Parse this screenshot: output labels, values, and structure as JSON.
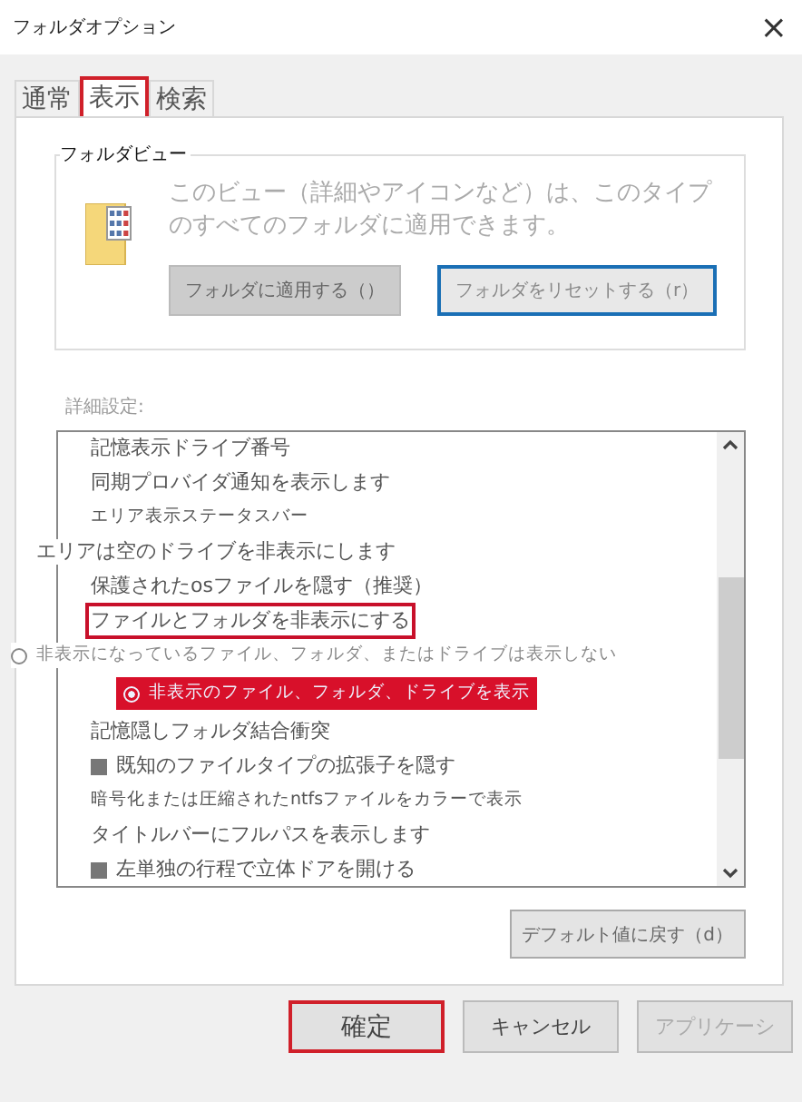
{
  "window": {
    "title": "フォルダオプション",
    "close": "×"
  },
  "tabs": [
    {
      "label": "通常",
      "selected": false,
      "highlighted": false
    },
    {
      "label": "表示",
      "selected": true,
      "highlighted": true
    },
    {
      "label": "検索",
      "selected": false,
      "highlighted": false
    }
  ],
  "folder_view": {
    "title": "フォルダビュー",
    "description": "このビュー（詳細やアイコンなど）は、このタイプのすべてのフォルダに適用できます。",
    "buttons": [
      {
        "label": "フォルダに適用する（）",
        "disabled": true,
        "focused": false
      },
      {
        "label": "フォルダをリセットする（r）",
        "disabled": false,
        "focused": true
      }
    ]
  },
  "advanced": {
    "label": "詳細設定:",
    "items": [
      {
        "kind": "text",
        "label": "記憶表示ドライブ番号",
        "highlighted": false
      },
      {
        "kind": "text",
        "label": "同期プロバイダ通知を表示します",
        "highlighted": false
      },
      {
        "kind": "small",
        "label": "エリア表示ステータスバー",
        "highlighted": false
      },
      {
        "kind": "outdented",
        "label": "エリアは空のドライブを非表示にします",
        "highlighted": false
      },
      {
        "kind": "text",
        "label": "保護されたosファイルを隠す（推奨）",
        "highlighted": false
      },
      {
        "kind": "text",
        "label": "ファイルとフォルダを非表示にする",
        "highlighted": true
      },
      {
        "kind": "radio",
        "label": "非表示になっているファイル、フォルダ、またはドライブは表示しない",
        "selected": false,
        "highlighted": false
      },
      {
        "kind": "radio",
        "label": "非表示のファイル、フォルダ、ドライブを表示",
        "selected": true,
        "highlighted": true
      },
      {
        "kind": "text",
        "label": "記憶隠しフォルダ結合衝突",
        "highlighted": false
      },
      {
        "kind": "checkbox",
        "label": "既知のファイルタイプの拡張子を隠す",
        "checked": true,
        "highlighted": false
      },
      {
        "kind": "small",
        "label": "暗号化または圧縮されたntfsファイルをカラーで表示",
        "highlighted": false
      },
      {
        "kind": "text",
        "label": "タイトルバーにフルパスを表示します",
        "highlighted": false
      },
      {
        "kind": "checkbox",
        "label": "左単独の行程で立体ドアを開ける",
        "checked": true,
        "highlighted": false
      }
    ],
    "reset_button": "デフォルト値に戻す（d）"
  },
  "buttons": [
    {
      "label": "確定",
      "highlighted": true,
      "disabled": false
    },
    {
      "label": "キャンセル",
      "highlighted": false,
      "disabled": false
    },
    {
      "label": "アプリケーシ",
      "highlighted": false,
      "disabled": true
    }
  ]
}
